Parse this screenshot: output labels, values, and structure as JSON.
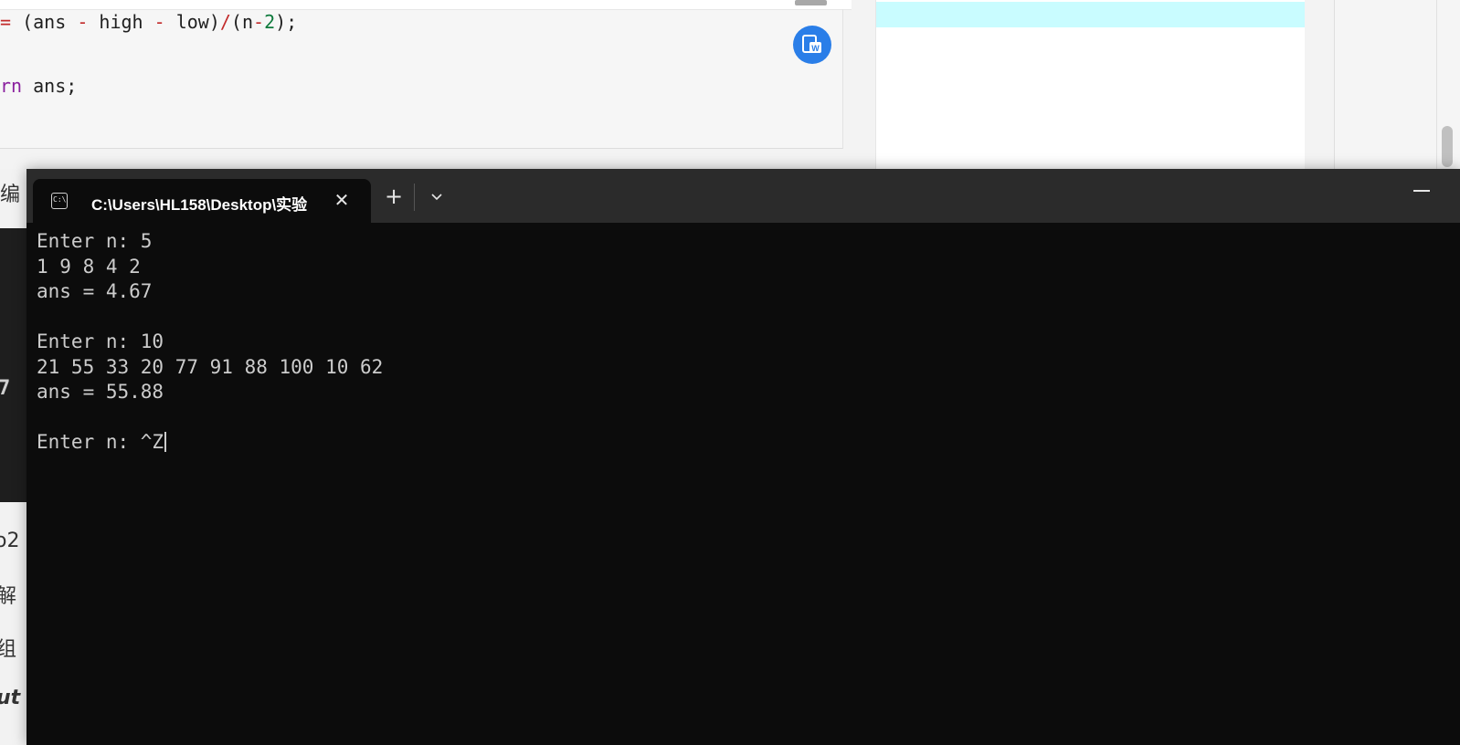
{
  "editor": {
    "line1": {
      "pre": "= ",
      "expr_a": "(ans ",
      "minus1": "-",
      "expr_b": " high ",
      "minus2": "-",
      "expr_c": " low)",
      "slash": "/",
      "expr_d": "(n",
      "minus3": "-",
      "two": "2",
      "expr_e": ");"
    },
    "line2": {
      "kw": "rn",
      "rest": " ans;"
    },
    "badge_icon": "word-icon"
  },
  "background_fragments": {
    "f1": "编",
    "f2": "7",
    "f3": "o2",
    "f4": "解",
    "f5": "组",
    "f6": "ut"
  },
  "terminal": {
    "tab_title": "C:\\Users\\HL158\\Desktop\\实验",
    "tab_icon_glyph": "C:\\",
    "close_glyph": "✕",
    "new_tab_glyph": "+",
    "lines": [
      "Enter n: 5",
      "1 9 8 4 2",
      "ans = 4.67",
      "",
      "Enter n: 10",
      "21 55 33 20 77 91 88 100 10 62",
      "ans = 55.88",
      "",
      "Enter n: ^Z"
    ]
  },
  "colors": {
    "terminal_bg": "#0c0c0c",
    "tabbar_bg": "#2b2b2b",
    "terminal_text": "#cccccc",
    "highlight_cyan": "#c9fcff",
    "badge_blue": "#2a7ee8"
  }
}
